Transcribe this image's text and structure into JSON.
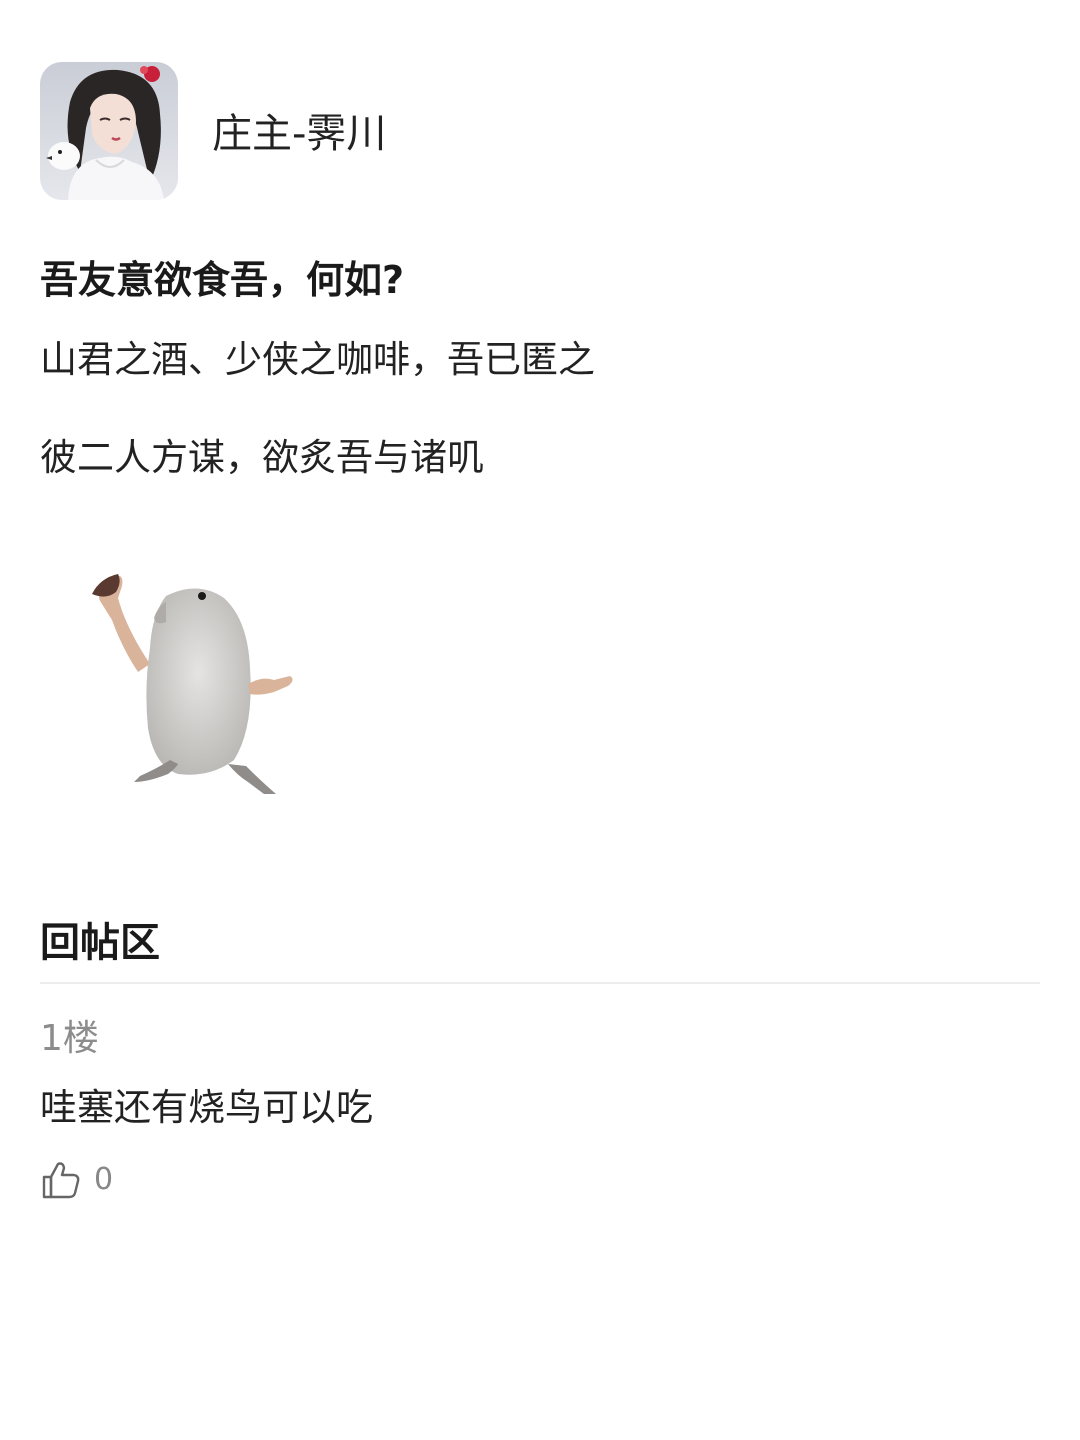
{
  "post": {
    "author": "庄主-霁川",
    "title": "吾友意欲食吾，何如?",
    "lines": [
      "山君之酒、少侠之咖啡，吾已匿之",
      "彼二人方谋，欲炙吾与诸叽"
    ]
  },
  "replies": {
    "heading": "回帖区",
    "items": [
      {
        "floor": "1楼",
        "text": "哇塞还有烧鸟可以吃",
        "likes": "0"
      }
    ]
  },
  "icons": {
    "like": "thumbs-up-icon",
    "avatar": "avatar-image",
    "post_image": "dancing-bird-image"
  },
  "colors": {
    "text": "#222222",
    "muted": "#8c8c8c",
    "divider": "#ededed"
  }
}
